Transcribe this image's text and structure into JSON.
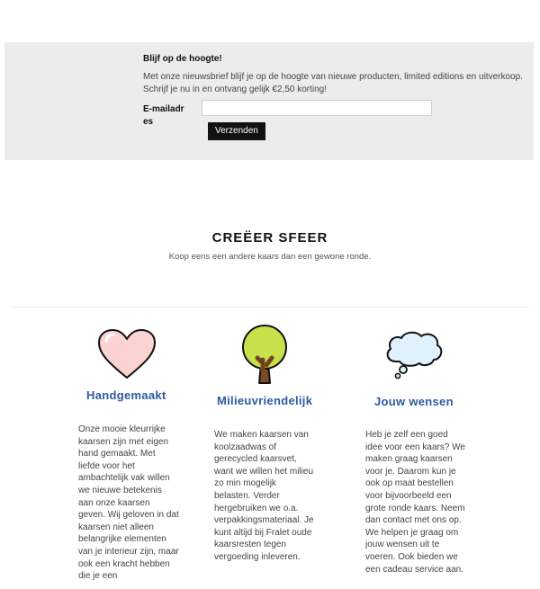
{
  "newsletter": {
    "title": "Blijf op de hoogte!",
    "text": "Met onze nieuwsbrief blijf je op de hoogte van nieuwe producten, limited editions en uitverkoop. Schrijf je nu in en ontvang gelijk €2,50 korting!",
    "email_label": "E-mailadres",
    "email_value": "",
    "submit_label": "Verzenden"
  },
  "hero": {
    "title": "CREËER SFEER",
    "subtitle": "Koop eens een andere kaars dan een gewone ronde."
  },
  "features": [
    {
      "icon": "heart-icon",
      "title": "Handgemaakt",
      "text": "Onze mooie kleurrijke kaarsen zijn met eigen hand gemaakt. Met liefde voor het ambachtelijk vak willen we nieuwe betekenis aan onze kaarsen geven. Wij geloven in dat kaarsen niet alleen belangrijke elementen van je interieur zijn, maar ook een kracht hebben die je een"
    },
    {
      "icon": "tree-icon",
      "title": "Milieuvriendelijk",
      "text": "We maken kaarsen van koolzaadwas of gerecycled kaarsvet, want we willen het milieu zo min mogelijk belasten. Verder hergebruiken we o.a. verpakkingsmateriaal. Je kunt altijd bij Fralet oude kaarsresten tegen vergoeding inleveren."
    },
    {
      "icon": "thought-cloud-icon",
      "title": "Jouw wensen",
      "text": "Heb je zelf een goed idee voor een kaars? We maken graag kaarsen voor je. Daarom kun je ook op maat bestellen voor bijvoorbeeld een grote ronde kaars. Neem dan contact met ons op. We helpen je graag om jouw wensen uit te voeren. Ook bieden we een cadeau service aan."
    }
  ],
  "colors": {
    "newsletter_bg": "#ececec",
    "feature_title": "#2d5aa0",
    "button_bg": "#111111",
    "heart_fill": "#fbd3d3",
    "tree_canopy": "#c8e04a",
    "tree_trunk": "#7a4a24",
    "cloud_fill": "#dff1fb"
  }
}
